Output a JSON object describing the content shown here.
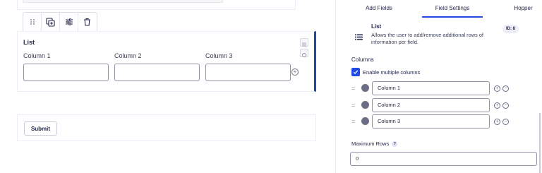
{
  "canvas": {
    "list_field": {
      "label": "List",
      "columns": [
        "Column 1",
        "Column 2",
        "Column 3"
      ]
    },
    "submit_label": "Submit"
  },
  "panel": {
    "tabs": [
      "Add Fields",
      "Field Settings",
      "Hopper"
    ],
    "active_tab": "Field Settings",
    "field": {
      "title": "List",
      "description": "Allows the user to add/remove additional rows of information per field.",
      "id_badge": "ID: 8"
    },
    "columns_section_label": "Columns",
    "enable_multiple_columns_label": "Enable multiple columns",
    "enable_multiple_columns_checked": true,
    "column_choices": [
      "Column 1",
      "Column 2",
      "Column 3"
    ],
    "maximum_rows_label": "Maximum Rows",
    "maximum_rows_value": "0"
  },
  "colors": {
    "accent": "#204ce5",
    "selected_border": "#1e4e9a"
  }
}
